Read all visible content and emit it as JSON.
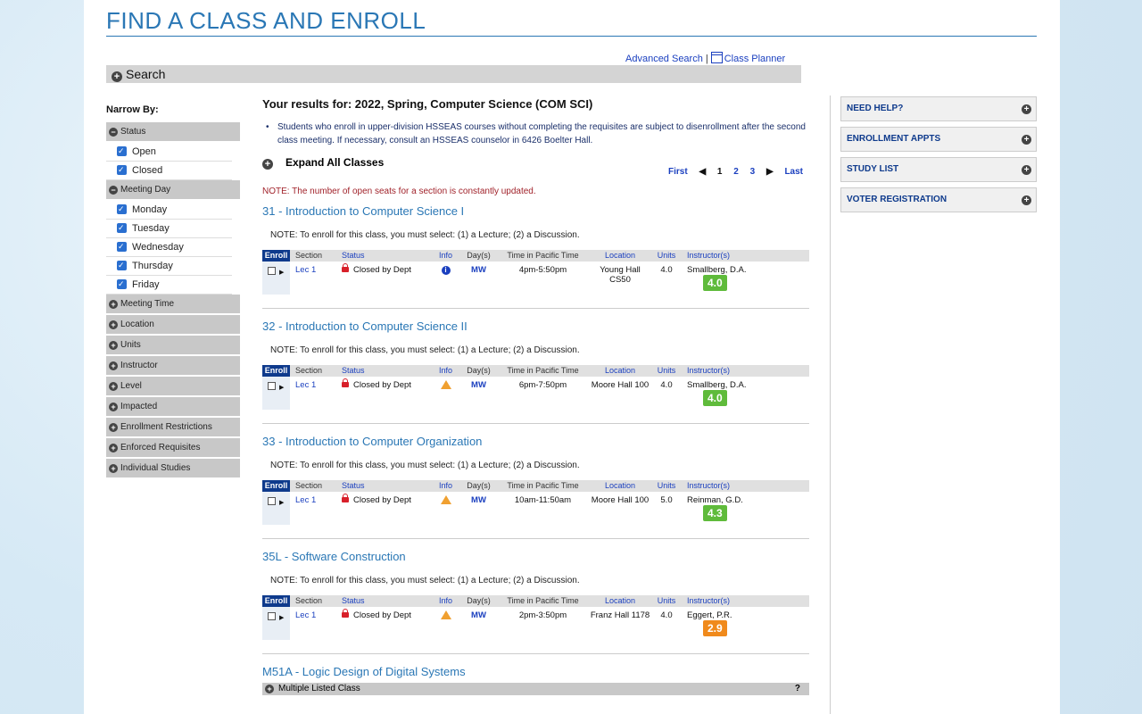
{
  "page_title": "FIND A CLASS AND ENROLL",
  "top_links": {
    "advanced_search": "Advanced Search",
    "separator": "|",
    "class_planner": "Class Planner"
  },
  "search_bar": {
    "label": "Search"
  },
  "sidebar": {
    "title": "Narrow By:",
    "status": {
      "label": "Status",
      "options": [
        "Open",
        "Closed"
      ]
    },
    "meeting_day": {
      "label": "Meeting Day",
      "options": [
        "Monday",
        "Tuesday",
        "Wednesday",
        "Thursday",
        "Friday"
      ]
    },
    "collapsed": [
      "Meeting Time",
      "Location",
      "Units",
      "Instructor",
      "Level",
      "Impacted",
      "Enrollment Restrictions",
      "Enforced Requisites",
      "Individual Studies"
    ]
  },
  "results": {
    "title": "Your results for: 2022, Spring, Computer Science (COM SCI)",
    "notice": "Students who enroll in upper-division HSSEAS courses without completing the requisites are subject to disenrollment after the second class meeting. If necessary, consult an HSSEAS counselor in 6426 Boelter Hall.",
    "expand_all": "Expand All Classes",
    "pager": {
      "first": "First",
      "pages": [
        "1",
        "2",
        "3"
      ],
      "last": "Last"
    },
    "open_seats_note": "NOTE: The number of open seats for a section is constantly updated."
  },
  "table_headers": {
    "enroll": "Enroll",
    "section": "Section",
    "status": "Status",
    "info": "Info",
    "days": "Day(s)",
    "time": "Time in Pacific Time",
    "location": "Location",
    "units": "Units",
    "instructor": "Instructor(s)"
  },
  "courses": [
    {
      "title": "31 - Introduction to Computer Science I",
      "note": "NOTE: To enroll for this class, you must select: (1) a Lecture; (2) a Discussion.",
      "section": "Lec 1",
      "status": "Closed by Dept",
      "info": "info",
      "days": "MW",
      "time": "4pm-5:50pm",
      "location": "Young Hall CS50",
      "units": "4.0",
      "instructor": "Smallberg, D.A.",
      "rating": "4.0",
      "rating_color": "#5fbb3b"
    },
    {
      "title": "32 - Introduction to Computer Science II",
      "note": "NOTE: To enroll for this class, you must select: (1) a Lecture; (2) a Discussion.",
      "section": "Lec 1",
      "status": "Closed by Dept",
      "info": "warning",
      "days": "MW",
      "time": "6pm-7:50pm",
      "location": "Moore Hall 100",
      "units": "4.0",
      "instructor": "Smallberg, D.A.",
      "rating": "4.0",
      "rating_color": "#5fbb3b"
    },
    {
      "title": "33 - Introduction to Computer Organization",
      "note": "NOTE: To enroll for this class, you must select: (1) a Lecture; (2) a Discussion.",
      "section": "Lec 1",
      "status": "Closed by Dept",
      "info": "warning",
      "days": "MW",
      "time": "10am-11:50am",
      "location": "Moore Hall 100",
      "units": "5.0",
      "instructor": "Reinman, G.D.",
      "rating": "4.3",
      "rating_color": "#5fbb3b"
    },
    {
      "title": "35L - Software Construction",
      "note": "NOTE: To enroll for this class, you must select: (1) a Lecture; (2) a Discussion.",
      "section": "Lec 1",
      "status": "Closed by Dept",
      "info": "warning",
      "days": "MW",
      "time": "2pm-3:50pm",
      "location": "Franz Hall 1178",
      "units": "4.0",
      "instructor": "Eggert, P.R.",
      "rating": "2.9",
      "rating_color": "#f08a1c"
    }
  ],
  "m51a": {
    "title": "M51A - Logic Design of Digital Systems",
    "bar": "Multiple Listed Class",
    "help_mark": "?"
  },
  "help_panel": [
    "NEED HELP?",
    "ENROLLMENT APPTS",
    "STUDY LIST",
    "VOTER REGISTRATION"
  ]
}
